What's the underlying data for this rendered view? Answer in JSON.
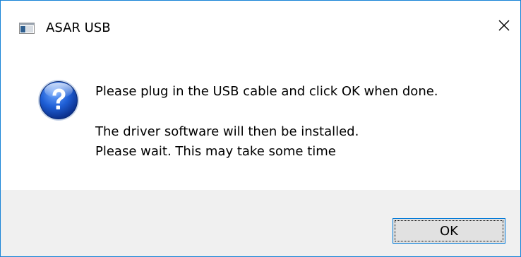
{
  "window": {
    "title": "ASAR USB",
    "app_icon": "window-app-icon",
    "close_icon": "close-icon"
  },
  "content": {
    "icon": "question-icon",
    "message_line1": "Please plug in the USB cable and click OK when done.",
    "message_line2": "The driver software will then be installed.",
    "message_line3": "Please wait. This may take some time"
  },
  "buttons": {
    "ok_label": "OK"
  },
  "colors": {
    "window_border": "#1883d7",
    "footer_bg": "#f0f0f0",
    "button_border": "#0078d7",
    "button_bg": "#e1e1e1"
  }
}
